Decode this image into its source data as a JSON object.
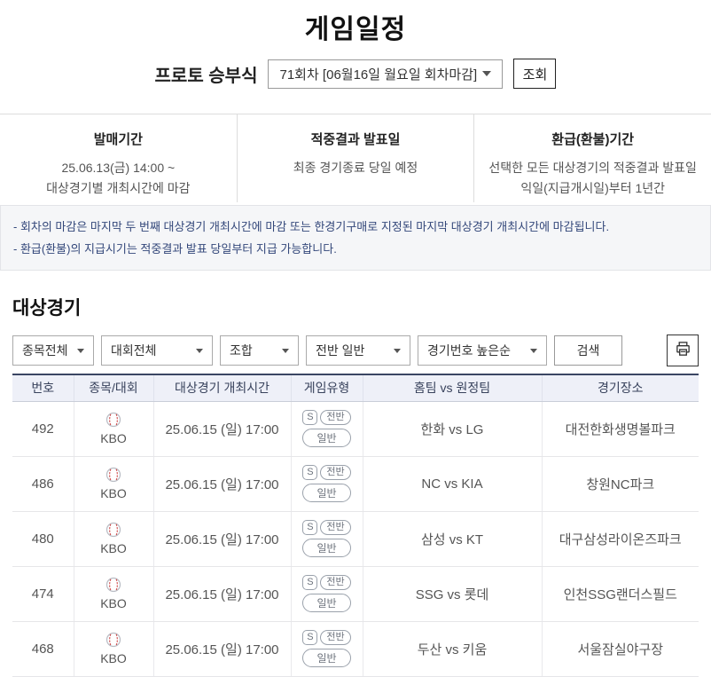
{
  "page": {
    "title": "게임일정"
  },
  "header": {
    "game_label": "프로토 승부식",
    "round_select_value": "71회차 [06월16일 월요일 회차마감]",
    "inquiry_button": "조회"
  },
  "info": {
    "columns": [
      {
        "title": "발매기간",
        "line1": "25.06.13(금) 14:00 ~",
        "line2": "대상경기별 개최시간에 마감"
      },
      {
        "title": "적중결과 발표일",
        "line1": "최종 경기종료 당일 예정",
        "line2": ""
      },
      {
        "title": "환급(환불)기간",
        "line1": "선택한 모든 대상경기의 적중결과 발표일",
        "line2": "익일(지급개시일)부터 1년간"
      }
    ]
  },
  "notes": [
    "- 회차의 마감은 마지막 두 번째 대상경기 개최시간에 마감 또는 한경기구매로 지정된 마지막 대상경기 개최시간에 마감됩니다.",
    "- 환급(환불)의 지급시기는 적중결과 발표 당일부터 지급 가능합니다."
  ],
  "section": {
    "title": "대상경기"
  },
  "filters": {
    "selects": [
      "종목전체",
      "대회전체",
      "조합",
      "전반 일반",
      "경기번호 높은순"
    ],
    "search_button": "검색",
    "print_icon": "printer-icon"
  },
  "table": {
    "headers": [
      "번호",
      "종목/대회",
      "대상경기 개최시간",
      "게임유형",
      "홈팀 vs 원정팀",
      "경기장소"
    ],
    "badge_s": "S",
    "badge_half": "전반",
    "badge_normal": "일반",
    "sport_icon": "baseball-icon",
    "rows": [
      {
        "no": "492",
        "league": "KBO",
        "time": "25.06.15 (일) 17:00",
        "match": "한화  vs  LG",
        "venue": "대전한화생명볼파크"
      },
      {
        "no": "486",
        "league": "KBO",
        "time": "25.06.15 (일) 17:00",
        "match": "NC  vs  KIA",
        "venue": "창원NC파크"
      },
      {
        "no": "480",
        "league": "KBO",
        "time": "25.06.15 (일) 17:00",
        "match": "삼성  vs  KT",
        "venue": "대구삼성라이온즈파크"
      },
      {
        "no": "474",
        "league": "KBO",
        "time": "25.06.15 (일) 17:00",
        "match": "SSG  vs  롯데",
        "venue": "인천SSG랜더스필드"
      },
      {
        "no": "468",
        "league": "KBO",
        "time": "25.06.15 (일) 17:00",
        "match": "두산  vs  키움",
        "venue": "서울잠실야구장"
      }
    ]
  },
  "colors": {
    "accent_navy": "#3a4663",
    "note_text": "#33477a",
    "header_bg": "#eef0f8",
    "badge_gray": "#9aa1ab",
    "stitch_red": "#cf4a4a"
  }
}
